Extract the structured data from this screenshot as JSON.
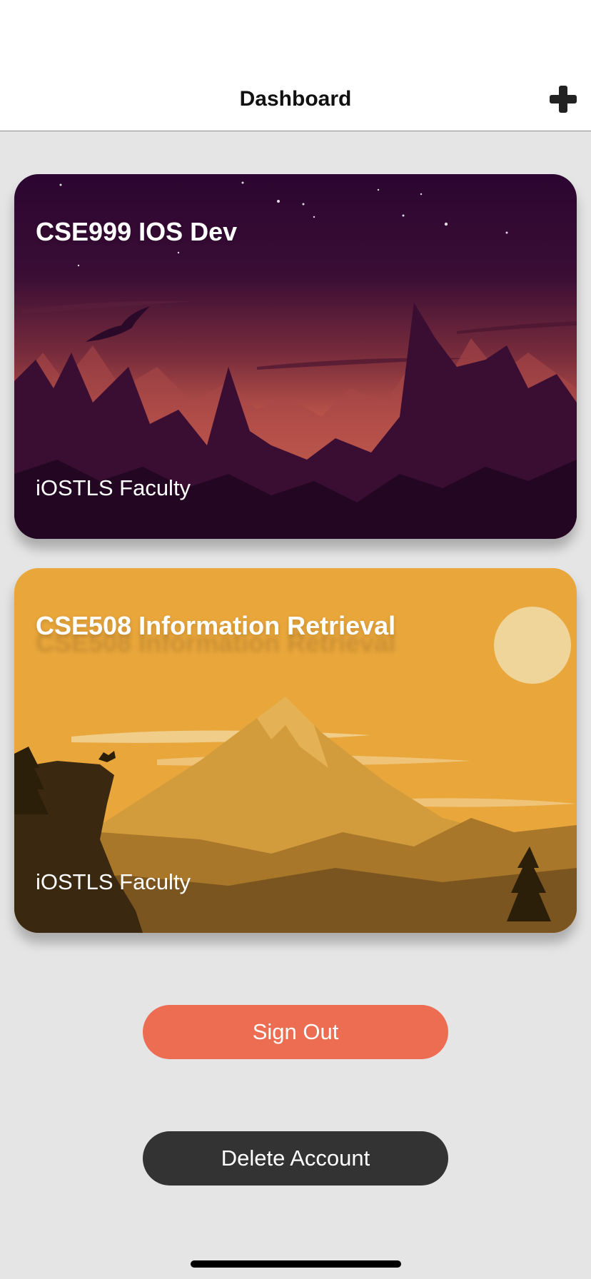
{
  "nav": {
    "title": "Dashboard",
    "add_icon": "plus-icon"
  },
  "courses": [
    {
      "title": "CSE999 IOS Dev",
      "subtitle": "iOSTLS Faculty",
      "theme": "purple-mountain-night",
      "accent": "#2e0a33"
    },
    {
      "title": "CSE508 Information Retrieval",
      "subtitle": "iOSTLS Faculty",
      "theme": "golden-mountain-sunset",
      "accent": "#e8a63b"
    }
  ],
  "actions": {
    "sign_out_label": "Sign Out",
    "sign_out_color": "#ec6d51",
    "delete_label": "Delete Account",
    "delete_color": "#333333"
  }
}
